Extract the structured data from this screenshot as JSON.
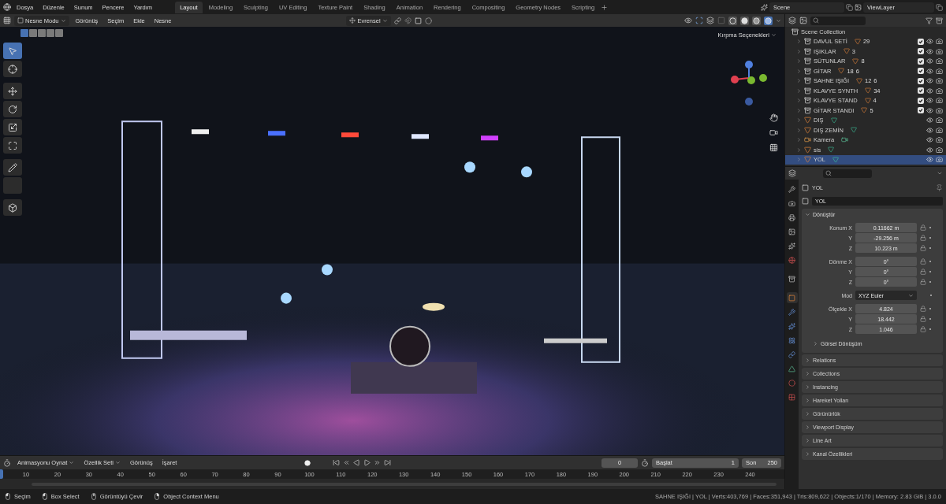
{
  "menu": [
    "Dosya",
    "Düzenle",
    "Sunum",
    "Pencere",
    "Yardım"
  ],
  "workspaces": [
    {
      "label": "Layout",
      "selected": true
    },
    {
      "label": "Modeling",
      "selected": false
    },
    {
      "label": "Sculpting",
      "selected": false
    },
    {
      "label": "UV Editing",
      "selected": false
    },
    {
      "label": "Texture Paint",
      "selected": false
    },
    {
      "label": "Shading",
      "selected": false
    },
    {
      "label": "Animation",
      "selected": false
    },
    {
      "label": "Rendering",
      "selected": false
    },
    {
      "label": "Compositing",
      "selected": false
    },
    {
      "label": "Geometry Nodes",
      "selected": false
    },
    {
      "label": "Scripting",
      "selected": false
    }
  ],
  "scene": "Scene",
  "view_layer": "ViewLayer",
  "viewport": {
    "mode": "Nesne Modu",
    "menus": [
      "Görünüş",
      "Seçim",
      "Ekle",
      "Nesne"
    ],
    "orientation": "Evrensel",
    "clipping": "Kırpma Seçenekleri",
    "select_modes": [
      {
        "selected": true
      },
      {
        "selected": false
      },
      {
        "selected": false
      },
      {
        "selected": false
      },
      {
        "selected": false
      }
    ],
    "shading": [
      {
        "kind": "wire",
        "selected": false
      },
      {
        "kind": "solid",
        "selected": false
      },
      {
        "kind": "material",
        "selected": false
      },
      {
        "kind": "rendered",
        "selected": true
      }
    ],
    "tools": [
      {
        "kind": "select",
        "selected": true
      },
      {
        "kind": "cursor",
        "selected": false
      },
      {
        "kind": "move",
        "selected": false
      },
      {
        "kind": "rotate",
        "selected": false
      },
      {
        "kind": "scale",
        "selected": false
      },
      {
        "kind": "transform",
        "selected": false
      },
      {
        "kind": "annotate",
        "selected": false
      },
      {
        "kind": "measure",
        "selected": false
      },
      {
        "kind": "add-cube",
        "selected": false
      }
    ]
  },
  "outliner": {
    "root": "Scene Collection",
    "items": [
      {
        "name": "DAVUL SETİ",
        "kind": "collection",
        "counts": [
          "29"
        ],
        "checked": true,
        "selected": false
      },
      {
        "name": "IŞIKLAR",
        "kind": "collection",
        "counts": [
          "3"
        ],
        "checked": true,
        "selected": false
      },
      {
        "name": "SÜTUNLAR",
        "kind": "collection",
        "counts": [
          "8"
        ],
        "checked": true,
        "selected": false
      },
      {
        "name": "GİTAR",
        "kind": "collection",
        "counts": [
          "18",
          "6"
        ],
        "checked": true,
        "selected": false
      },
      {
        "name": "SAHNE IŞIĞI",
        "kind": "collection",
        "counts": [
          "12",
          "6"
        ],
        "checked": true,
        "selected": false
      },
      {
        "name": "KLAVYE SYNTH",
        "kind": "collection",
        "counts": [
          "34"
        ],
        "checked": true,
        "selected": false
      },
      {
        "name": "KLAVYE STAND",
        "kind": "collection",
        "counts": [
          "4"
        ],
        "checked": true,
        "selected": false
      },
      {
        "name": "GİTAR STANDI",
        "kind": "collection",
        "counts": [
          "5"
        ],
        "checked": true,
        "selected": false
      },
      {
        "name": "DIŞ",
        "kind": "mesh",
        "selected": false
      },
      {
        "name": "DIŞ ZEMİN",
        "kind": "mesh",
        "selected": false
      },
      {
        "name": "Kamera",
        "kind": "camera",
        "selected": false
      },
      {
        "name": "sis",
        "kind": "mesh",
        "selected": false
      },
      {
        "name": "YOL",
        "kind": "mesh",
        "selected": true
      }
    ]
  },
  "properties": {
    "object_name": "YOL",
    "data_name": "YOL",
    "tabs": [
      {
        "kind": "tool",
        "selected": false
      },
      {
        "kind": "render",
        "selected": false
      },
      {
        "kind": "output",
        "selected": false
      },
      {
        "kind": "view-layer",
        "selected": false
      },
      {
        "kind": "scene",
        "selected": false
      },
      {
        "kind": "world",
        "selected": false
      },
      {
        "kind": "collection",
        "selected": false
      },
      {
        "kind": "object",
        "selected": true
      },
      {
        "kind": "modifier",
        "selected": false
      },
      {
        "kind": "particles",
        "selected": false
      },
      {
        "kind": "physics",
        "selected": false
      },
      {
        "kind": "constraints",
        "selected": false
      },
      {
        "kind": "data",
        "selected": false
      },
      {
        "kind": "material",
        "selected": false
      },
      {
        "kind": "texture",
        "selected": false
      }
    ],
    "transform": {
      "title": "Dönüştür",
      "expanded": true,
      "groups": [
        {
          "rows": [
            {
              "kind": "field",
              "label": "Konum X",
              "value": "0.11662 m"
            },
            {
              "kind": "field",
              "label": "Y",
              "value": "-29.256 m"
            },
            {
              "kind": "field",
              "label": "Z",
              "value": "10.223 m"
            }
          ]
        },
        {
          "rows": [
            {
              "kind": "field",
              "label": "Dönme X",
              "value": "0°"
            },
            {
              "kind": "field",
              "label": "Y",
              "value": "0°"
            },
            {
              "kind": "field",
              "label": "Z",
              "value": "0°"
            }
          ]
        },
        {
          "rows": [
            {
              "kind": "select",
              "label": "Mod",
              "value": "XYZ Euler"
            }
          ]
        },
        {
          "rows": [
            {
              "kind": "field",
              "label": "Ölçekle X",
              "value": "4.824"
            },
            {
              "kind": "field",
              "label": "Y",
              "value": "18.442"
            },
            {
              "kind": "field",
              "label": "Z",
              "value": "1.046"
            }
          ]
        }
      ],
      "subpanel": "Görsel Dönüşüm"
    },
    "panels": [
      "Relations",
      "Collections",
      "Instancing",
      "Hareket Yolları",
      "Görünürlük",
      "Viewport Display",
      "Line Art",
      "Kanal Özellikleri"
    ]
  },
  "timeline": {
    "menus": [
      {
        "label": "Animasyonu Oynat",
        "kind": "dropdown"
      },
      {
        "label": "Özellik Seti",
        "kind": "dropdown"
      },
      {
        "label": "Görünüş",
        "kind": "menu"
      },
      {
        "label": "İşaret",
        "kind": "menu"
      }
    ],
    "current_frame": "0",
    "start_label": "Başlat",
    "start": "1",
    "end_label": "Son",
    "end": "250",
    "ticks": [
      "10",
      "20",
      "30",
      "40",
      "50",
      "60",
      "70",
      "80",
      "90",
      "100",
      "110",
      "120",
      "130",
      "140",
      "150",
      "160",
      "170",
      "180",
      "190",
      "200",
      "210",
      "220",
      "230",
      "240"
    ]
  },
  "status": {
    "hints": [
      {
        "kind": "mouse-left",
        "label": "Seçim"
      },
      {
        "kind": "mouse-drag",
        "label": "Box Select"
      },
      {
        "kind": "mouse-middle",
        "label": "Görüntüyü Çevir"
      },
      {
        "kind": "mouse-right",
        "label": "Object Context Menu"
      }
    ],
    "stats": "SAHNE IŞIĞI | YOL | Verts:403,769 | Faces:351,943 | Tris:809,622 | Objects:1/170 | Memory: 2.83 GiB | 3.0.0"
  }
}
